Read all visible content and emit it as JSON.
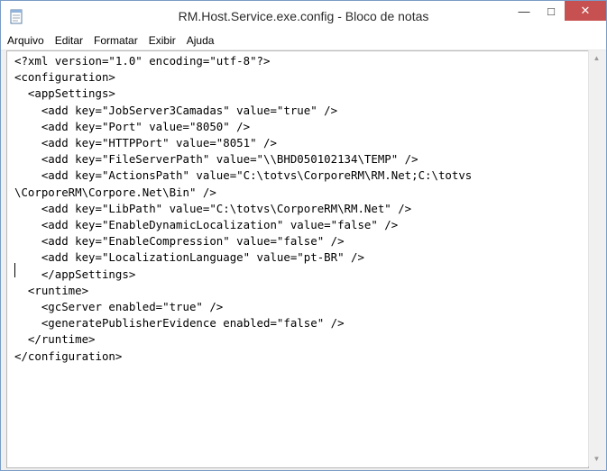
{
  "window": {
    "title": "RM.Host.Service.exe.config - Bloco de notas"
  },
  "controls": {
    "minimize": "—",
    "maximize": "□",
    "close": "✕"
  },
  "menu": [
    "Arquivo",
    "Editar",
    "Formatar",
    "Exibir",
    "Ajuda"
  ],
  "document": {
    "lines": [
      "<?xml version=\"1.0\" encoding=\"utf-8\"?>",
      "<configuration>",
      "  <appSettings>",
      "    <add key=\"JobServer3Camadas\" value=\"true\" />",
      "    <add key=\"Port\" value=\"8050\" />",
      "    <add key=\"HTTPPort\" value=\"8051\" />",
      "    <add key=\"FileServerPath\" value=\"\\\\BHD050102134\\TEMP\" />",
      "    <add key=\"ActionsPath\" value=\"C:\\totvs\\CorporeRM\\RM.Net;C:\\totvs",
      "\\CorporeRM\\Corpore.Net\\Bin\" />",
      "    <add key=\"LibPath\" value=\"C:\\totvs\\CorporeRM\\RM.Net\" />",
      "    <add key=\"EnableDynamicLocalization\" value=\"false\" />",
      "    <add key=\"EnableCompression\" value=\"false\" />",
      "    <add key=\"LocalizationLanguage\" value=\"pt-BR\" />",
      "    </appSettings>",
      "  <runtime>",
      "    <gcServer enabled=\"true\" />",
      "    <generatePublisherEvidence enabled=\"false\" />",
      "  </runtime>",
      "</configuration>"
    ]
  },
  "icons": {
    "app": "notepad-icon",
    "scroll_up": "scroll-up-arrow-icon",
    "scroll_down": "scroll-down-arrow-icon"
  }
}
